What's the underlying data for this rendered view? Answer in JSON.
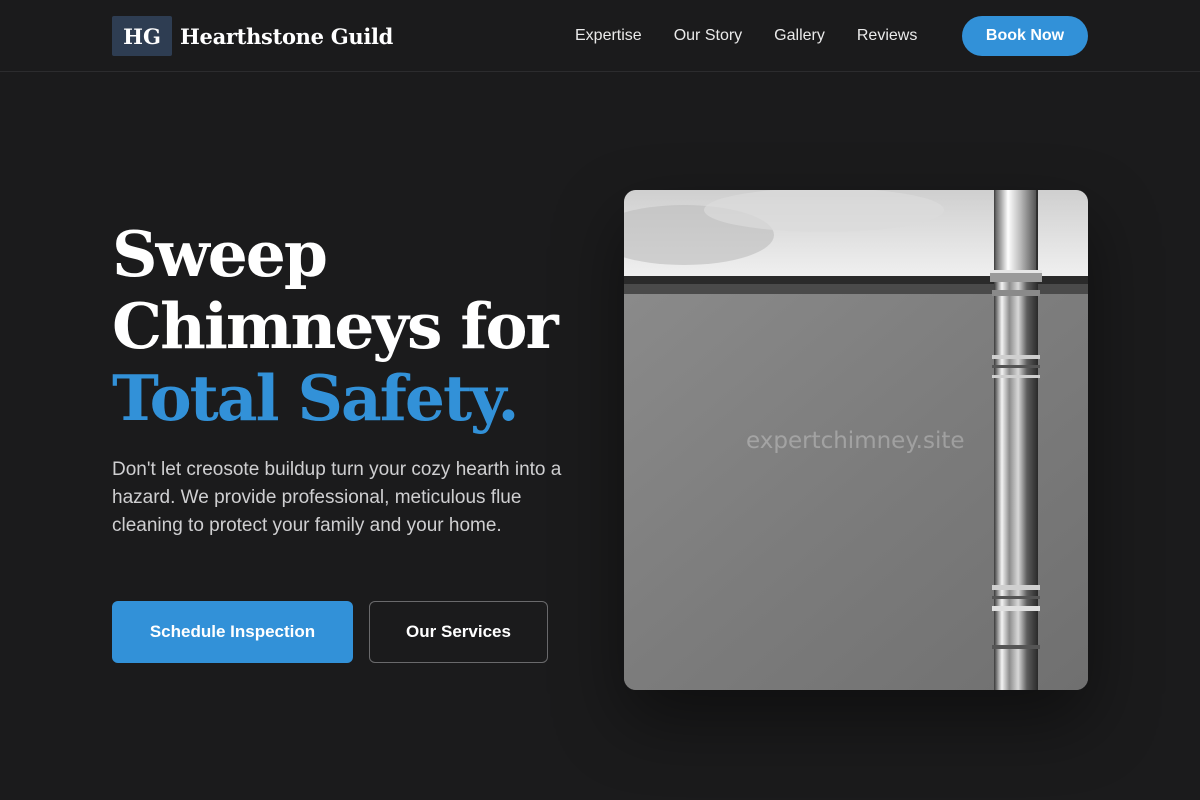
{
  "brand": {
    "mark": "HG",
    "name": "Hearthstone Guild"
  },
  "nav": {
    "links": [
      "Expertise",
      "Our Story",
      "Gallery",
      "Reviews"
    ],
    "cta": "Book Now"
  },
  "hero": {
    "headline_lines": [
      "Sweep",
      "Chimneys for"
    ],
    "headline_accent": "Total Safety.",
    "description": "Don't let creosote buildup turn your cozy hearth into a hazard. We provide professional, meticulous flue cleaning to protect your family and your home.",
    "primary_button": "Schedule Inspection",
    "secondary_button": "Our Services",
    "image_watermark": "expertchimney.site"
  },
  "colors": {
    "background": "#1b1b1c",
    "accent": "#3291d8",
    "logo_box": "#2e3d52"
  }
}
